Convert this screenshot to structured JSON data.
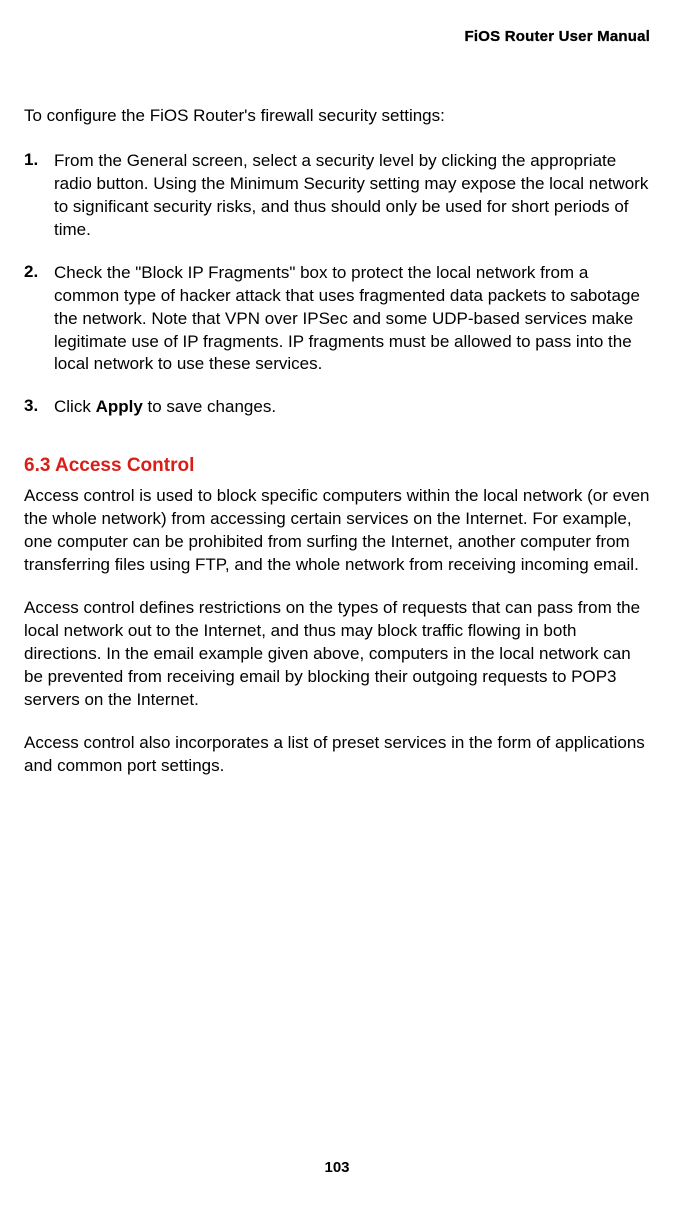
{
  "header": {
    "title": "FiOS Router User Manual"
  },
  "intro": "To configure the FiOS Router's firewall security settings:",
  "steps": [
    {
      "num": "1.",
      "text": "From the General screen, select a security level by clicking the appropriate radio button. Using the Minimum Security setting may expose the local network to significant security risks, and thus should only be used for short periods of time."
    },
    {
      "num": "2.",
      "text": "Check the \"Block IP Fragments\" box to protect the local network from a common type of hacker attack that uses fragmented data packets to sabotage the network. Note that VPN over IPSec and some UDP-based services make legitimate use of IP fragments. IP fragments must be allowed to pass into the local network to use these services."
    },
    {
      "num": "3.",
      "prefix": "Click ",
      "bold": "Apply",
      "suffix": " to save changes."
    }
  ],
  "section": {
    "heading": "6.3  Access Control",
    "para1": "Access control is used to block specific computers within the local network (or even the whole network) from accessing certain services on the Internet. For example, one computer can be prohibited from surfing the Internet, another computer from transferring files using FTP, and the whole network from receiving incoming email.",
    "para2": "Access control defines restrictions on the types of requests that can pass from the local network out to the Internet, and thus may block traffic flowing in both directions. In the email example given above, computers in the local network can be prevented from receiving email by blocking their outgoing requests to POP3 servers on the Internet.",
    "para3": "Access control also incorporates a list of preset services in the form of applications and common port settings."
  },
  "pageNumber": "103"
}
